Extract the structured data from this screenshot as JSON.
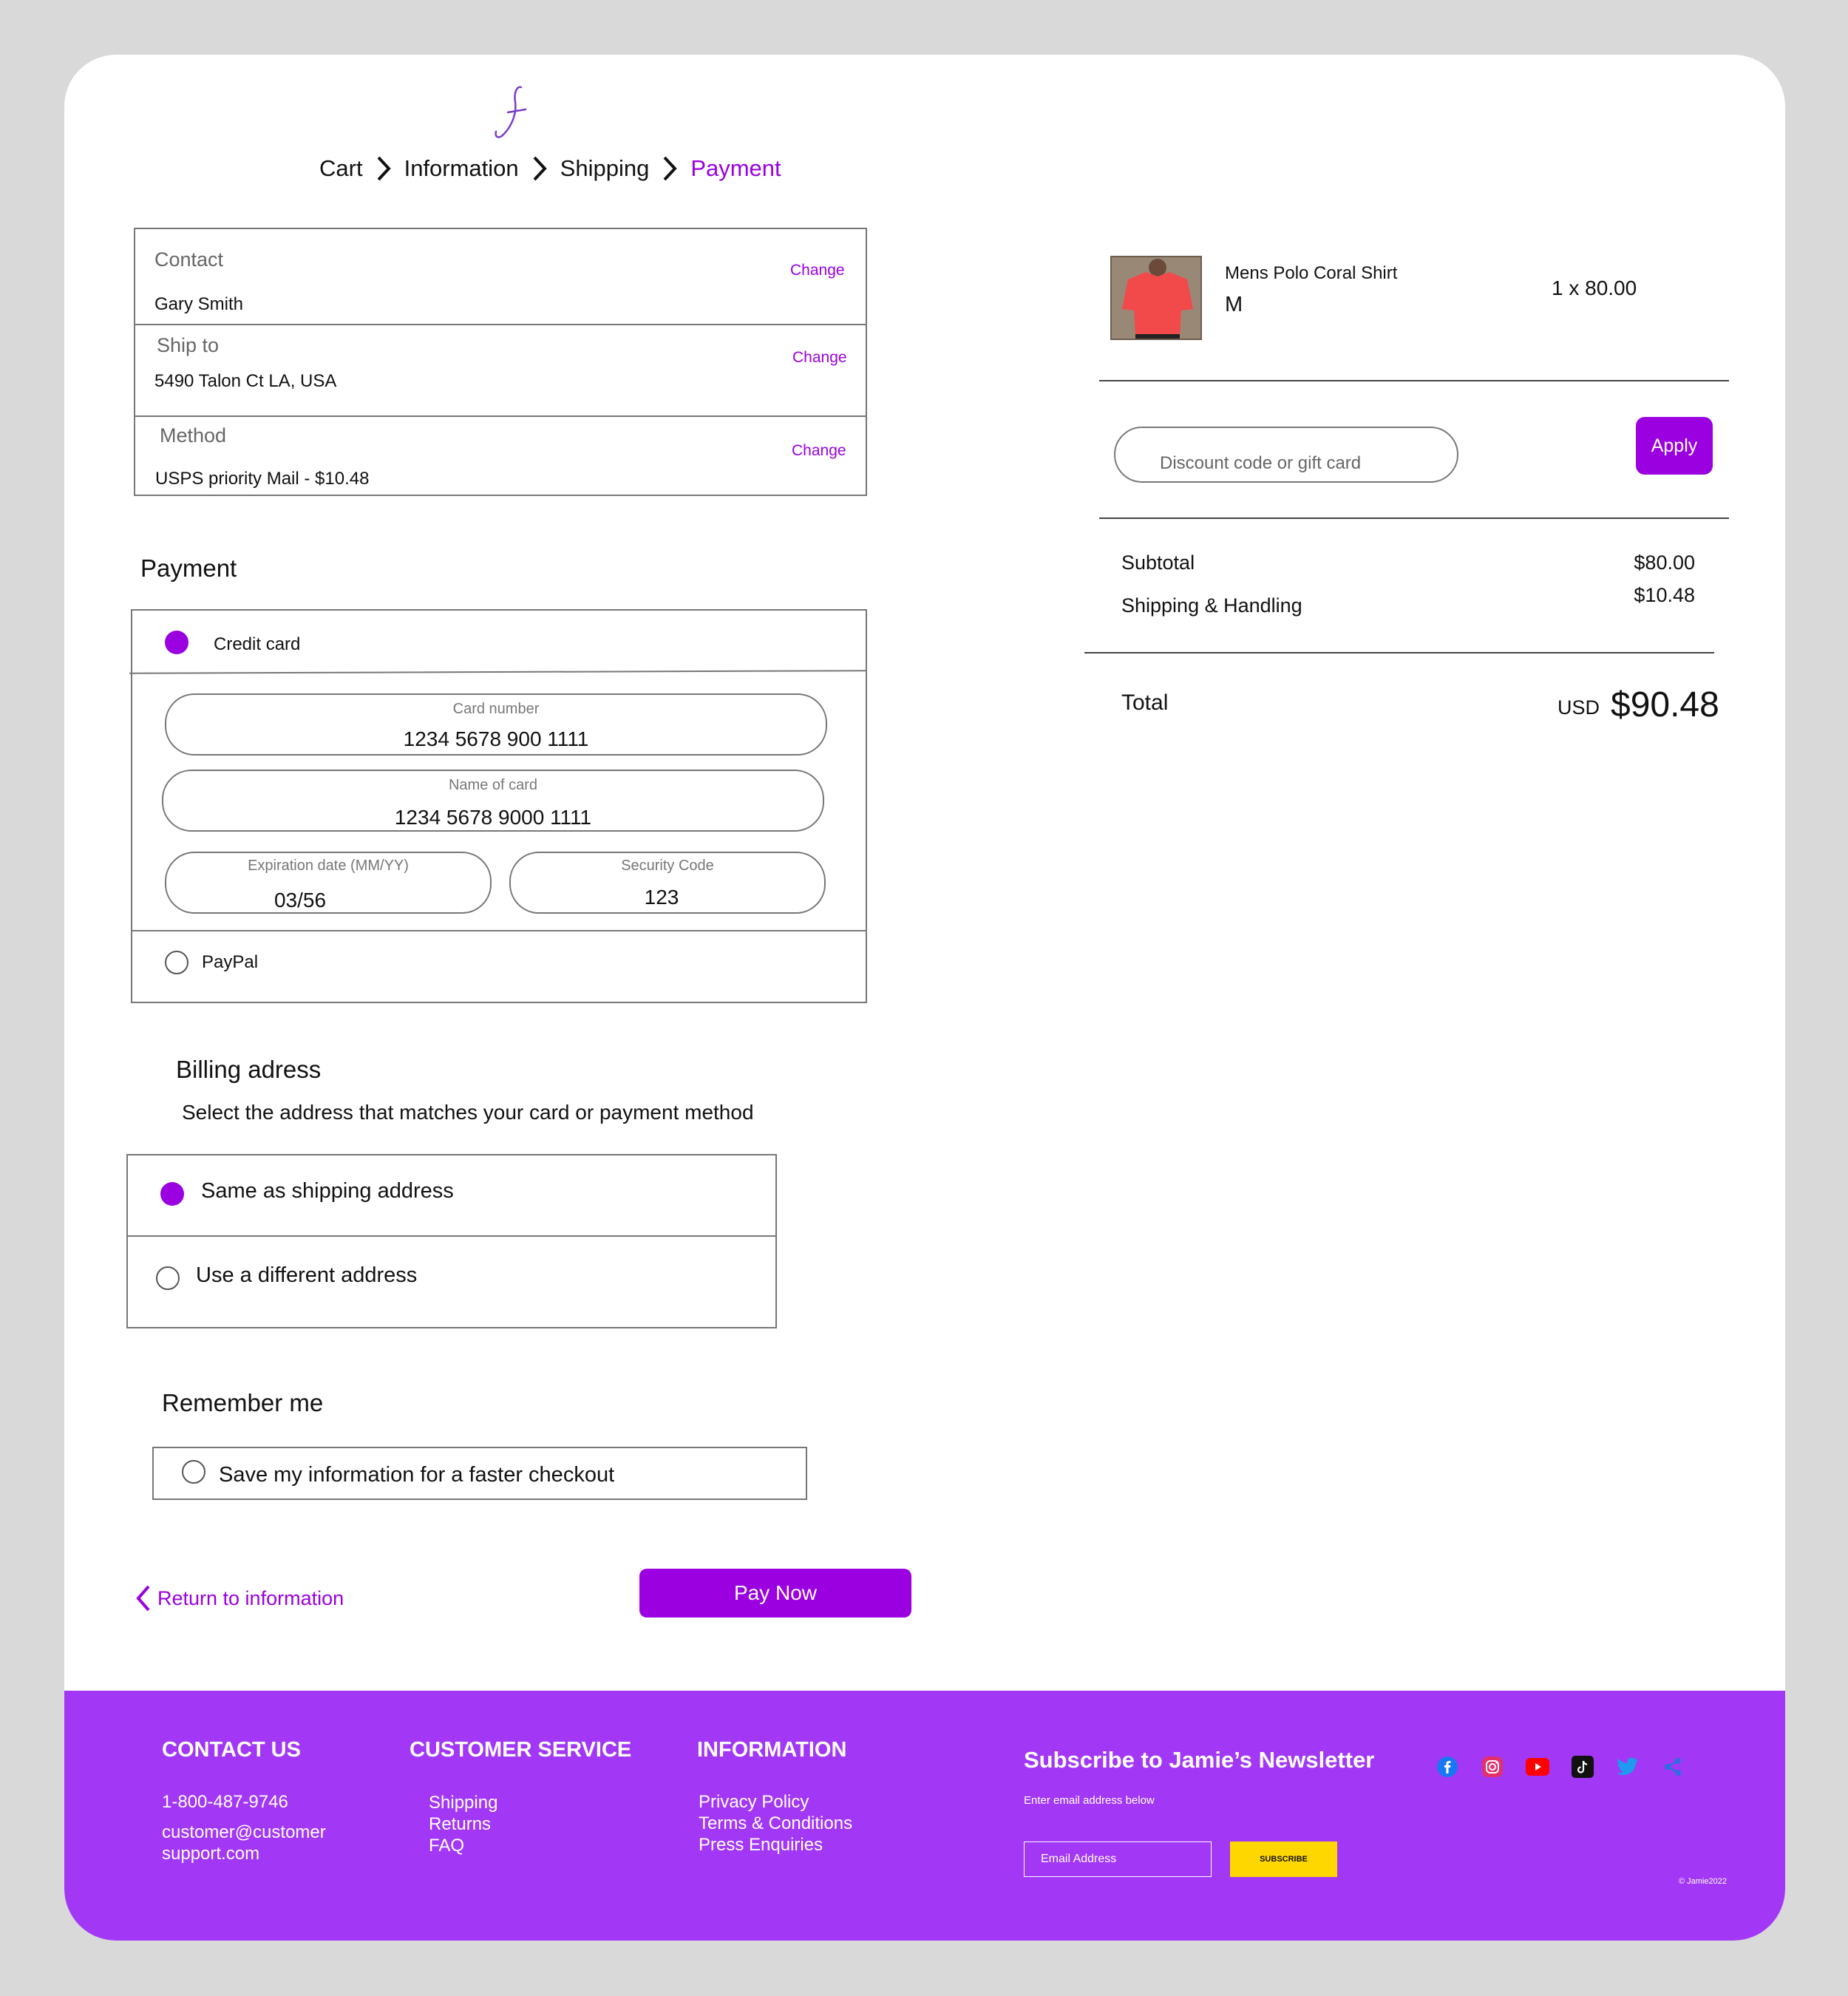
{
  "breadcrumb": {
    "cart": "Cart",
    "information": "Information",
    "shipping": "Shipping",
    "payment": "Payment"
  },
  "summary_box": {
    "contact_label": "Contact",
    "contact_value": "Gary Smith",
    "ship_label": "Ship to",
    "ship_value": "5490 Talon Ct LA, USA",
    "method_label": "Method",
    "method_value": "USPS priority Mail - $10.48",
    "change": "Change"
  },
  "payment": {
    "heading": "Payment",
    "credit_card_label": "Credit card",
    "card_number_label": "Card number",
    "card_number_value": "1234 5678 900 1111",
    "name_label": "Name of card",
    "name_value": "1234 5678 9000 1111",
    "exp_label": "Expiration date (MM/YY)",
    "exp_value": "03/56",
    "cvc_label": "Security Code",
    "cvc_value": "123",
    "paypal_label": "PayPal",
    "selected": "credit-card"
  },
  "billing": {
    "heading": "Billing adress",
    "subtitle": "Select the address that matches your card or payment method",
    "same_label": "Same as shipping address",
    "different_label": "Use a different address",
    "selected": "same"
  },
  "remember": {
    "heading": "Remember me",
    "label": "Save my information for a faster checkout"
  },
  "actions": {
    "return_label": "Return to information",
    "pay_label": "Pay Now"
  },
  "order": {
    "product_name": "Mens Polo Coral Shirt",
    "product_size": "M",
    "product_qty": "1 x 80.00",
    "discount_placeholder": "Discount code or gift card",
    "apply_label": "Apply",
    "subtotal_label": "Subtotal",
    "subtotal_value": "$80.00",
    "shipping_label": "Shipping & Handling",
    "shipping_value": "$10.48",
    "total_label": "Total",
    "total_currency": "USD",
    "total_value": "$90.48"
  },
  "footer": {
    "contact_heading": "CONTACT US",
    "phone": "1-800-487-9746",
    "email_line1": "customer@customer",
    "email_line2": "support.com",
    "service_heading": "CUSTOMER SERVICE",
    "service_links": [
      "Shipping",
      "Returns",
      "FAQ"
    ],
    "info_heading": "INFORMATION",
    "info_links": [
      "Privacy Policy",
      "Terms & Conditions",
      "Press Enquiries"
    ],
    "newsletter_title": "Subscribe to Jamie’s Newsletter",
    "newsletter_sub": "Enter email address below",
    "email_placeholder": "Email Address",
    "subscribe_label": "SUBSCRIBE",
    "copyright": "© Jamie2022",
    "social_icons": [
      "facebook-icon",
      "instagram-icon",
      "youtube-icon",
      "tiktok-icon",
      "twitter-icon",
      "share-icon"
    ]
  },
  "colors": {
    "accent": "#9a00e0",
    "footer_bg": "#a238f5",
    "subscribe_bg": "#ffd700",
    "page_bg": "#d9d9d9"
  }
}
